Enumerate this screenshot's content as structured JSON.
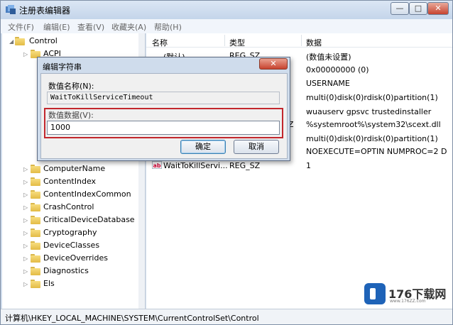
{
  "window": {
    "title": "注册表编辑器",
    "min_glyph": "—",
    "max_glyph": "□",
    "close_glyph": "✕"
  },
  "menu": [
    "文件(F)",
    "编辑(E)",
    "查看(V)",
    "收藏夹(A)",
    "帮助(H)"
  ],
  "tree": {
    "root": "Control",
    "items": [
      "ACPI",
      "ComputerName",
      "ContentIndex",
      "ContentIndexCommon",
      "CrashControl",
      "CriticalDeviceDatabase",
      "Cryptography",
      "DeviceClasses",
      "DeviceOverrides",
      "Diagnostics",
      "Els"
    ]
  },
  "list": {
    "headers": [
      "名称",
      "类型",
      "数据"
    ],
    "rows": [
      {
        "name": "(默认)",
        "type": "REG_SZ",
        "data": "(数值未设置)"
      },
      {
        "name": "",
        "type": "",
        "data": "0x00000000 (0)"
      },
      {
        "name": "",
        "type": "",
        "data": "USERNAME"
      },
      {
        "name": "",
        "type": "",
        "data": "multi(0)disk(0)rdisk(0)partition(1)"
      },
      {
        "name": "",
        "type": "",
        "data": "wuauserv gpsvc trustedinstaller"
      },
      {
        "name": "",
        "type": "Z",
        "data": "%systemroot%\\system32\\scext.dll"
      },
      {
        "name": "",
        "type": "",
        "data": "multi(0)disk(0)rdisk(0)partition(1)"
      },
      {
        "name": "",
        "type": "",
        "data": " NOEXECUTE=OPTIN  NUMPROC=2 D"
      },
      {
        "name": "WaitToKillServi...",
        "type": "REG_SZ",
        "data": "1"
      }
    ]
  },
  "status": "计算机\\HKEY_LOCAL_MACHINE\\SYSTEM\\CurrentControlSet\\Control",
  "dialog": {
    "title": "编辑字符串",
    "close_glyph": "✕",
    "name_label": "数值名称(N):",
    "name_value": "WaitToKillServiceTimeout",
    "data_label": "数值数据(V):",
    "data_value": "1000",
    "ok": "确定",
    "cancel": "取消"
  },
  "watermark": {
    "text": "176下载网",
    "url": "www.176ZZ.com"
  },
  "colors": {
    "highlight": "#c2272d",
    "frame": "#cfdcec"
  }
}
